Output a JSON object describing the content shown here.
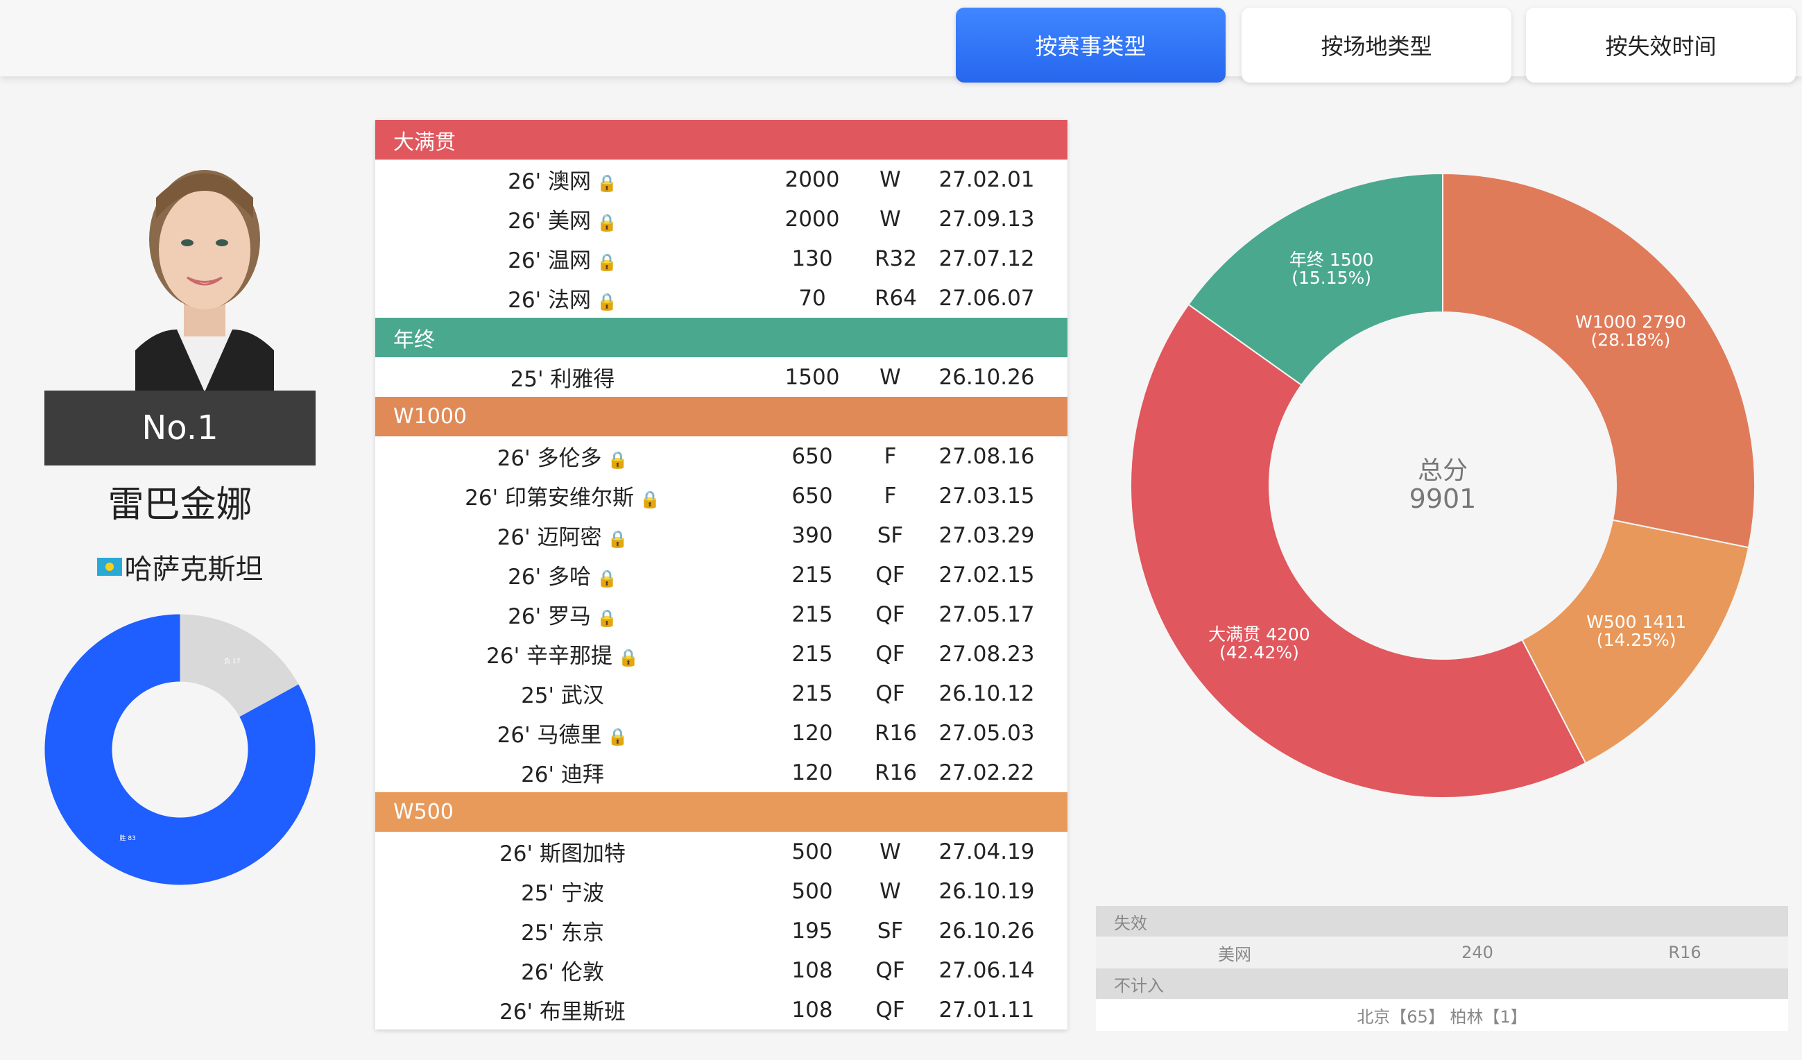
{
  "tabs": [
    "按赛事类型",
    "按场地类型",
    "按失效时间"
  ],
  "player": {
    "rank": "No.1",
    "name": "雷巴金娜",
    "country": "哈萨克斯坦"
  },
  "small_donut": {
    "labels": [
      "胜 83",
      "负 17"
    ],
    "values": [
      83,
      17
    ],
    "colors": [
      "#1f5eff",
      "#d9d9d9"
    ]
  },
  "sections": [
    {
      "title": "大满贯",
      "color": "#e0575d",
      "rows": [
        {
          "event": "26' 澳网",
          "locked": true,
          "points": "2000",
          "round": "W",
          "expires": "27.02.01"
        },
        {
          "event": "26' 美网",
          "locked": true,
          "points": "2000",
          "round": "W",
          "expires": "27.09.13"
        },
        {
          "event": "26' 温网",
          "locked": true,
          "points": "130",
          "round": "R32",
          "expires": "27.07.12"
        },
        {
          "event": "26' 法网",
          "locked": true,
          "points": "70",
          "round": "R64",
          "expires": "27.06.07"
        }
      ]
    },
    {
      "title": "年终",
      "color": "#4aa88f",
      "rows": [
        {
          "event": "25' 利雅得",
          "locked": false,
          "points": "1500",
          "round": "W",
          "expires": "26.10.26"
        }
      ]
    },
    {
      "title": "W1000",
      "color": "#e08a57",
      "rows": [
        {
          "event": "26' 多伦多",
          "locked": true,
          "points": "650",
          "round": "F",
          "expires": "27.08.16"
        },
        {
          "event": "26' 印第安维尔斯",
          "locked": true,
          "points": "650",
          "round": "F",
          "expires": "27.03.15"
        },
        {
          "event": "26' 迈阿密",
          "locked": true,
          "points": "390",
          "round": "SF",
          "expires": "27.03.29"
        },
        {
          "event": "26' 多哈",
          "locked": true,
          "points": "215",
          "round": "QF",
          "expires": "27.02.15"
        },
        {
          "event": "26' 罗马",
          "locked": true,
          "points": "215",
          "round": "QF",
          "expires": "27.05.17"
        },
        {
          "event": "26' 辛辛那提",
          "locked": true,
          "points": "215",
          "round": "QF",
          "expires": "27.08.23"
        },
        {
          "event": "25' 武汉",
          "locked": false,
          "points": "215",
          "round": "QF",
          "expires": "26.10.12"
        },
        {
          "event": "26' 马德里",
          "locked": true,
          "points": "120",
          "round": "R16",
          "expires": "27.05.03"
        },
        {
          "event": "26' 迪拜",
          "locked": false,
          "points": "120",
          "round": "R16",
          "expires": "27.02.22"
        }
      ]
    },
    {
      "title": "W500",
      "color": "#e89a5b",
      "rows": [
        {
          "event": "26' 斯图加特",
          "locked": false,
          "points": "500",
          "round": "W",
          "expires": "27.04.19"
        },
        {
          "event": "25' 宁波",
          "locked": false,
          "points": "500",
          "round": "W",
          "expires": "26.10.19"
        },
        {
          "event": "25' 东京",
          "locked": false,
          "points": "195",
          "round": "SF",
          "expires": "26.10.26"
        },
        {
          "event": "26' 伦敦",
          "locked": false,
          "points": "108",
          "round": "QF",
          "expires": "27.06.14"
        },
        {
          "event": "26' 布里斯班",
          "locked": false,
          "points": "108",
          "round": "QF",
          "expires": "27.01.11"
        }
      ]
    }
  ],
  "lock_glyph": "🔒",
  "chart_data": {
    "type": "pie",
    "center_title": "总分",
    "center_value": "9901",
    "slices": [
      {
        "label": "W1000 2790",
        "pct": "(28.18%)",
        "value": 2790,
        "color": "#e07b5a"
      },
      {
        "label": "W500 1411",
        "pct": "(14.25%)",
        "value": 1411,
        "color": "#e8985a"
      },
      {
        "label": "大满贯 4200",
        "pct": "(42.42%)",
        "value": 4200,
        "color": "#e0575d"
      },
      {
        "label": "年终 1500",
        "pct": "(15.15%)",
        "value": 1500,
        "color": "#4aa88f"
      }
    ]
  },
  "expired": {
    "title": "失效",
    "event": "美网",
    "points": "240",
    "round": "R16"
  },
  "not_counted": {
    "title": "不计入",
    "text": "北京【65】 柏林【1】"
  }
}
